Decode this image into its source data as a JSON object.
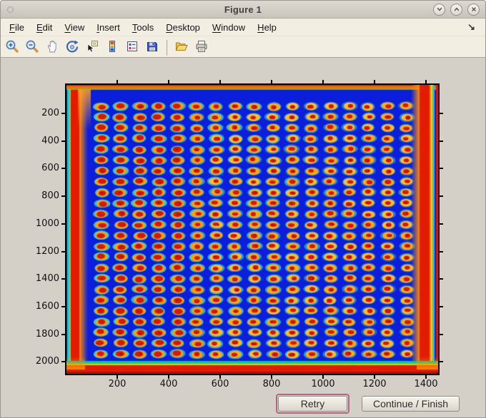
{
  "window": {
    "title": "Figure 1",
    "controls": [
      {
        "name": "minimize",
        "glyph": "chevron-down"
      },
      {
        "name": "maximize",
        "glyph": "chevron-up"
      },
      {
        "name": "close",
        "glyph": "x"
      }
    ]
  },
  "menu": {
    "items": [
      "File",
      "Edit",
      "View",
      "Insert",
      "Tools",
      "Desktop",
      "Window",
      "Help"
    ],
    "dock_icon": "↘"
  },
  "toolbar": {
    "items": [
      "zoom-in",
      "zoom-out",
      "pan",
      "rotate-3d",
      "data-cursor",
      "colorbar",
      "legend",
      "save",
      "separator",
      "open",
      "print"
    ]
  },
  "plot": {
    "description": "pseudocolor (jet colormap) scanned plate image: blue field with grid of red/yellow spots, red border bands",
    "x_ticks": [
      200,
      400,
      600,
      800,
      1000,
      1200,
      1400
    ],
    "y_ticks": [
      200,
      400,
      600,
      800,
      1000,
      1200,
      1400,
      1600,
      1800,
      2000
    ],
    "grid": {
      "rows": 24,
      "cols": 17
    },
    "colors": {
      "field": "#0A1EDC",
      "dot_red": "#DA1604",
      "dot_red_dark": "#B00C00",
      "dot_body_left": "#FFA200",
      "dot_body_right": "#FFBE2A",
      "halo_cyan": "#2ED4D4",
      "border_red": "#E31B00",
      "border_red_dark": "#B01000",
      "border_orange": "#FF8A00",
      "border_yellow": "#F2D800",
      "border_cyan": "#18C8E8",
      "bottom_green": "#20D860",
      "bottom_teal": "#00B8D8",
      "top_red": "#E02800"
    }
  },
  "buttons": {
    "retry": "Retry",
    "continue": "Continue / Finish"
  },
  "ui_colors": {
    "titlebar_top": "#DCD9D1",
    "titlebar_bottom": "#C8C4BC",
    "menubar_bg": "#F2EEE1",
    "figure_bg": "#D4D0C7",
    "focus_ring": "#AF6880"
  }
}
